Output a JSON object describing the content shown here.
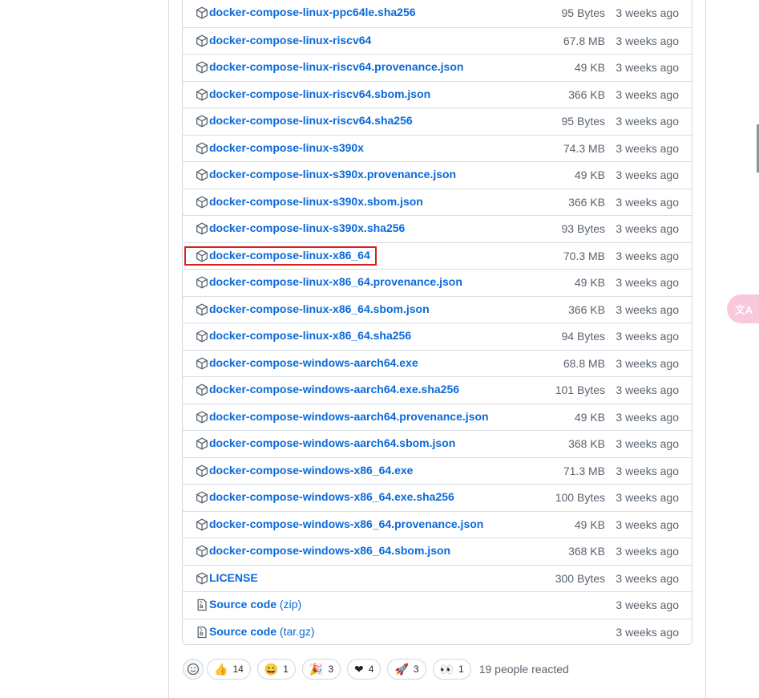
{
  "assets": [
    {
      "name": "docker-compose-linux-ppc64le.sha256",
      "size": "95 Bytes",
      "date": "3 weeks ago",
      "icon": "package-icon"
    },
    {
      "name": "docker-compose-linux-riscv64",
      "size": "67.8 MB",
      "date": "3 weeks ago",
      "icon": "package-icon"
    },
    {
      "name": "docker-compose-linux-riscv64.provenance.json",
      "size": "49 KB",
      "date": "3 weeks ago",
      "icon": "package-icon"
    },
    {
      "name": "docker-compose-linux-riscv64.sbom.json",
      "size": "366 KB",
      "date": "3 weeks ago",
      "icon": "package-icon"
    },
    {
      "name": "docker-compose-linux-riscv64.sha256",
      "size": "95 Bytes",
      "date": "3 weeks ago",
      "icon": "package-icon"
    },
    {
      "name": "docker-compose-linux-s390x",
      "size": "74.3 MB",
      "date": "3 weeks ago",
      "icon": "package-icon"
    },
    {
      "name": "docker-compose-linux-s390x.provenance.json",
      "size": "49 KB",
      "date": "3 weeks ago",
      "icon": "package-icon"
    },
    {
      "name": "docker-compose-linux-s390x.sbom.json",
      "size": "366 KB",
      "date": "3 weeks ago",
      "icon": "package-icon"
    },
    {
      "name": "docker-compose-linux-s390x.sha256",
      "size": "93 Bytes",
      "date": "3 weeks ago",
      "icon": "package-icon"
    },
    {
      "name": "docker-compose-linux-x86_64",
      "size": "70.3 MB",
      "date": "3 weeks ago",
      "icon": "package-icon"
    },
    {
      "name": "docker-compose-linux-x86_64.provenance.json",
      "size": "49 KB",
      "date": "3 weeks ago",
      "icon": "package-icon"
    },
    {
      "name": "docker-compose-linux-x86_64.sbom.json",
      "size": "366 KB",
      "date": "3 weeks ago",
      "icon": "package-icon"
    },
    {
      "name": "docker-compose-linux-x86_64.sha256",
      "size": "94 Bytes",
      "date": "3 weeks ago",
      "icon": "package-icon"
    },
    {
      "name": "docker-compose-windows-aarch64.exe",
      "size": "68.8 MB",
      "date": "3 weeks ago",
      "icon": "package-icon"
    },
    {
      "name": "docker-compose-windows-aarch64.exe.sha256",
      "size": "101 Bytes",
      "date": "3 weeks ago",
      "icon": "package-icon"
    },
    {
      "name": "docker-compose-windows-aarch64.provenance.json",
      "size": "49 KB",
      "date": "3 weeks ago",
      "icon": "package-icon"
    },
    {
      "name": "docker-compose-windows-aarch64.sbom.json",
      "size": "368 KB",
      "date": "3 weeks ago",
      "icon": "package-icon"
    },
    {
      "name": "docker-compose-windows-x86_64.exe",
      "size": "71.3 MB",
      "date": "3 weeks ago",
      "icon": "package-icon"
    },
    {
      "name": "docker-compose-windows-x86_64.exe.sha256",
      "size": "100 Bytes",
      "date": "3 weeks ago",
      "icon": "package-icon"
    },
    {
      "name": "docker-compose-windows-x86_64.provenance.json",
      "size": "49 KB",
      "date": "3 weeks ago",
      "icon": "package-icon"
    },
    {
      "name": "docker-compose-windows-x86_64.sbom.json",
      "size": "368 KB",
      "date": "3 weeks ago",
      "icon": "package-icon"
    },
    {
      "name": "LICENSE",
      "size": "300 Bytes",
      "date": "3 weeks ago",
      "icon": "package-icon"
    },
    {
      "name": "Source code",
      "ext": "(zip)",
      "size": "",
      "date": "3 weeks ago",
      "icon": "file-zip-icon"
    },
    {
      "name": "Source code",
      "ext": "(tar.gz)",
      "size": "",
      "date": "3 weeks ago",
      "icon": "file-zip-icon"
    }
  ],
  "highlighted_asset": "docker-compose-linux-x86_64",
  "reactions": [
    {
      "emoji": "👍",
      "icon": "thumbs-up-icon",
      "count": "14"
    },
    {
      "emoji": "😄",
      "icon": "laugh-icon",
      "count": "1"
    },
    {
      "emoji": "🎉",
      "icon": "hooray-icon",
      "count": "3"
    },
    {
      "emoji": "❤",
      "icon": "heart-icon",
      "count": "4"
    },
    {
      "emoji": "🚀",
      "icon": "rocket-icon",
      "count": "3"
    },
    {
      "emoji": "👀",
      "icon": "eyes-icon",
      "count": "1"
    }
  ],
  "reacted_text": "19 people reacted",
  "translate_button": {
    "label": "文A",
    "icon": "translate-icon"
  },
  "colors": {
    "link": "#0969da",
    "muted": "#59636e",
    "border": "#d0d7de",
    "highlight": "#d92020"
  }
}
